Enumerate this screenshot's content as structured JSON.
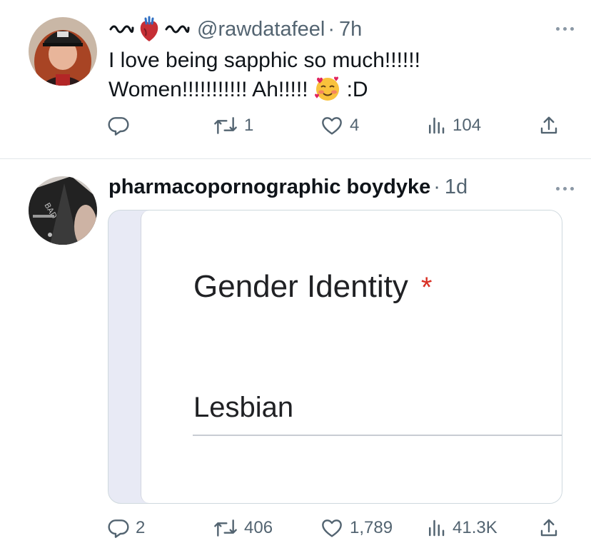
{
  "tweets": [
    {
      "name_decor": "〰️🫀〰️",
      "handle": "@rawdatafeel",
      "separator": "·",
      "time": "7h",
      "text_line1": "I love being sapphic so much!!!!!!",
      "text_line2_before": "Women!!!!!!!!!!! Ah!!!!!",
      "emoji": "smiling-face-with-hearts",
      "text_line2_after": ":D",
      "replies": "",
      "reposts": "1",
      "likes": "4",
      "views": "104"
    },
    {
      "display_name": "pharmacopornographic boydyke",
      "separator": "·",
      "time": "1d",
      "media": {
        "question": "Gender Identity",
        "required_marker": "*",
        "answer": "Lesbian"
      },
      "replies": "2",
      "reposts": "406",
      "likes": "1,789",
      "views": "41.3K"
    }
  ],
  "colors": {
    "text_primary": "#0f1419",
    "text_secondary": "#536471",
    "divider": "#e1e6ea",
    "required_red": "#d93025"
  }
}
